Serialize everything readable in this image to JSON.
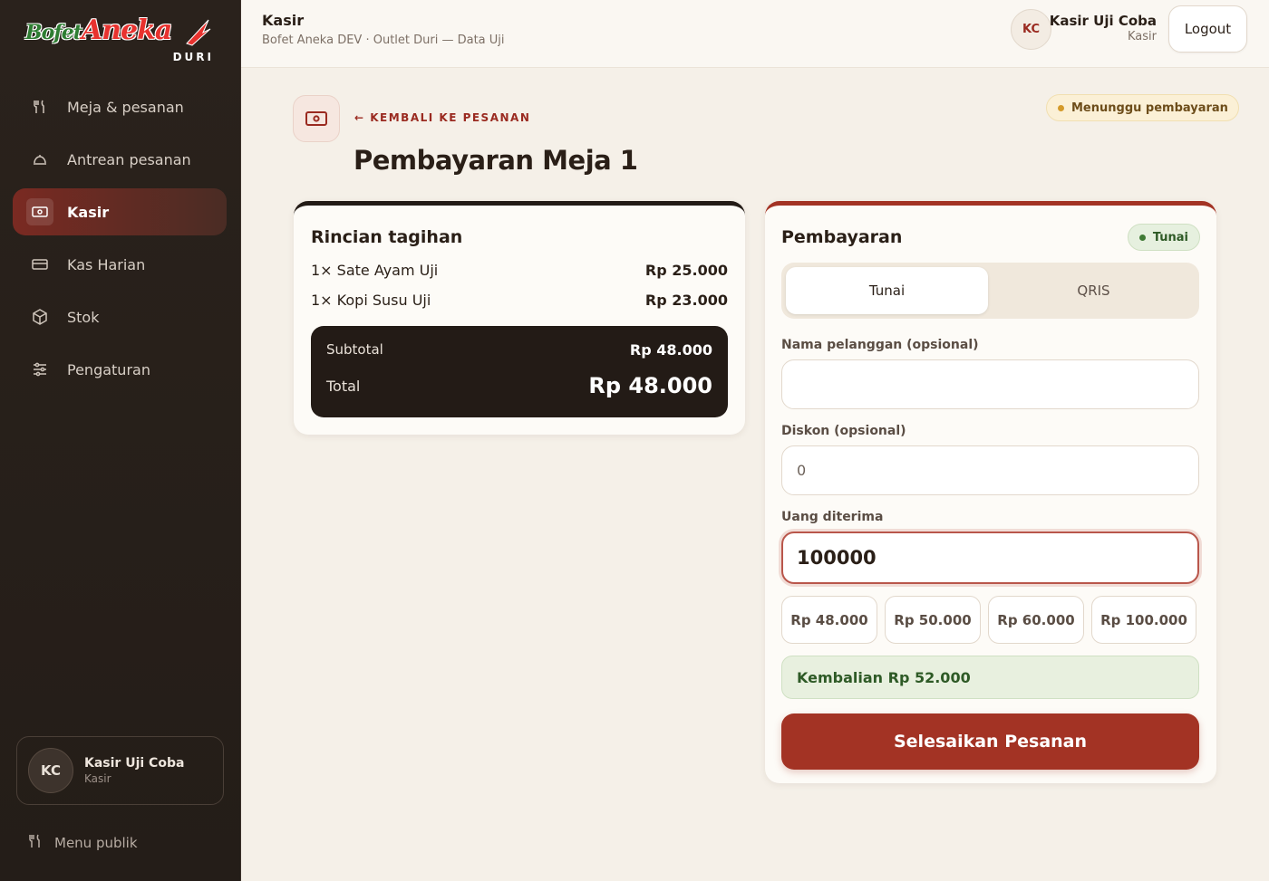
{
  "brand": {
    "word1": "Bofet",
    "word2": "Aneka",
    "word3": "DURI"
  },
  "sidebar": {
    "items": [
      {
        "label": "Meja & pesanan",
        "icon": "fork-knife-icon"
      },
      {
        "label": "Antrean pesanan",
        "icon": "cloche-icon"
      },
      {
        "label": "Kasir",
        "icon": "cash-icon",
        "active": true
      },
      {
        "label": "Kas Harian",
        "icon": "wallet-icon"
      },
      {
        "label": "Stok",
        "icon": "box-icon"
      },
      {
        "label": "Pengaturan",
        "icon": "sliders-icon"
      }
    ],
    "user": {
      "initials": "KC",
      "name": "Kasir Uji Coba",
      "role": "Kasir"
    },
    "public_menu": "Menu publik"
  },
  "topbar": {
    "title": "Kasir",
    "subtitle": "Bofet Aneka DEV · Outlet Duri — Data Uji",
    "user_initials": "KC",
    "user_name": "Kasir Uji Coba",
    "user_role": "Kasir",
    "logout": "Logout"
  },
  "page": {
    "back": "← KEMBALI KE PESANAN",
    "title": "Pembayaran Meja 1",
    "status": "Menunggu pembayaran"
  },
  "bill": {
    "title": "Rincian tagihan",
    "items": [
      {
        "name": "1× Sate Ayam Uji",
        "amount": "Rp 25.000"
      },
      {
        "name": "1× Kopi Susu Uji",
        "amount": "Rp 23.000"
      }
    ],
    "subtotal_label": "Subtotal",
    "subtotal": "Rp 48.000",
    "total_label": "Total",
    "total": "Rp 48.000"
  },
  "payment": {
    "title": "Pembayaran",
    "method_badge": "Tunai",
    "tabs": [
      "Tunai",
      "QRIS"
    ],
    "customer_label": "Nama pelanggan (opsional)",
    "customer_value": "",
    "discount_label": "Diskon (opsional)",
    "discount_value": "0",
    "received_label": "Uang diterima",
    "received_value": "100000",
    "quick_amounts": [
      "Rp 48.000",
      "Rp 50.000",
      "Rp 60.000",
      "Rp 100.000"
    ],
    "change": "Kembalian Rp 52.000",
    "finish": "Selesaikan Pesanan"
  },
  "colors": {
    "accent": "#a33324",
    "sidebar": "#2a221c",
    "success": "#2e5a26",
    "warning": "#d49a2a"
  }
}
